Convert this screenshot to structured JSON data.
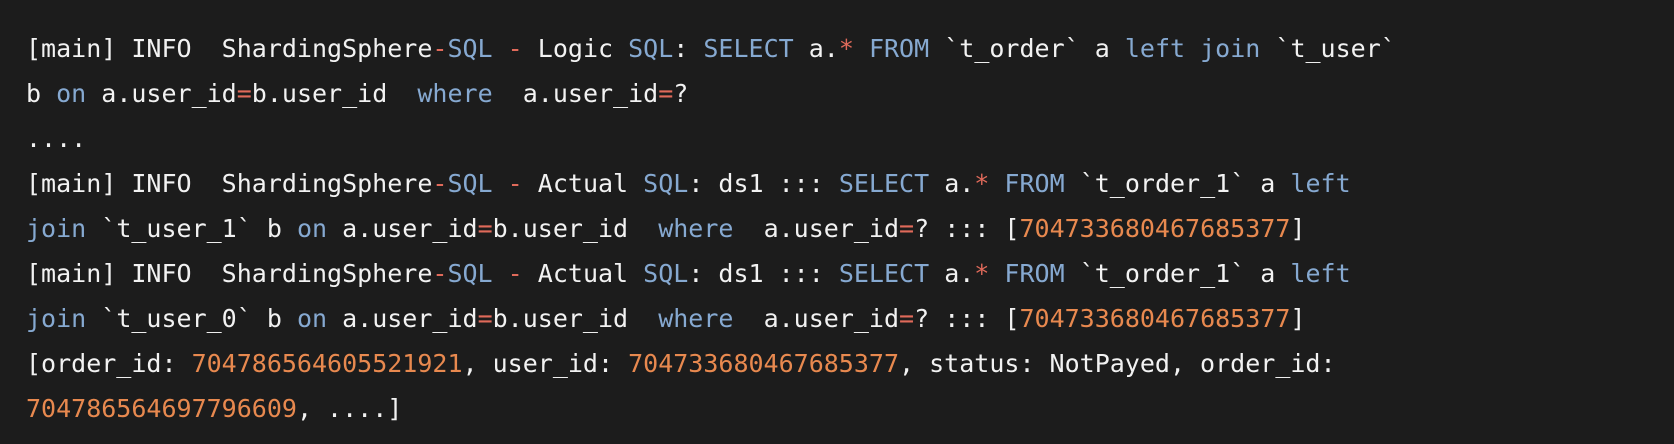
{
  "colors": {
    "background": "#1c1c1c",
    "default": "#f2f2f2",
    "keyword": "#86a9d1",
    "operator": "#e06a5a",
    "number": "#e8894f"
  },
  "code_lines": [
    [
      {
        "t": "[main] INFO  ShardingSphere",
        "c": "default"
      },
      {
        "t": "-",
        "c": "operator"
      },
      {
        "t": "SQL",
        "c": "keyword"
      },
      {
        "t": " ",
        "c": "default"
      },
      {
        "t": "-",
        "c": "operator"
      },
      {
        "t": " Logic ",
        "c": "default"
      },
      {
        "t": "SQL",
        "c": "keyword"
      },
      {
        "t": ": ",
        "c": "default"
      },
      {
        "t": "SELECT",
        "c": "keyword"
      },
      {
        "t": " a.",
        "c": "default"
      },
      {
        "t": "*",
        "c": "operator"
      },
      {
        "t": " ",
        "c": "default"
      },
      {
        "t": "FROM",
        "c": "keyword"
      },
      {
        "t": " `t_order` a ",
        "c": "default"
      },
      {
        "t": "left",
        "c": "keyword"
      },
      {
        "t": " ",
        "c": "default"
      },
      {
        "t": "join",
        "c": "keyword"
      },
      {
        "t": " `t_user`",
        "c": "default"
      }
    ],
    [
      {
        "t": "b ",
        "c": "default"
      },
      {
        "t": "on",
        "c": "keyword"
      },
      {
        "t": " a.user_id",
        "c": "default"
      },
      {
        "t": "=",
        "c": "operator"
      },
      {
        "t": "b.user_id  ",
        "c": "default"
      },
      {
        "t": "where",
        "c": "keyword"
      },
      {
        "t": "  a.user_id",
        "c": "default"
      },
      {
        "t": "=",
        "c": "operator"
      },
      {
        "t": "?",
        "c": "default"
      }
    ],
    [
      {
        "t": "....",
        "c": "default"
      }
    ],
    [
      {
        "t": "[main] INFO  ShardingSphere",
        "c": "default"
      },
      {
        "t": "-",
        "c": "operator"
      },
      {
        "t": "SQL",
        "c": "keyword"
      },
      {
        "t": " ",
        "c": "default"
      },
      {
        "t": "-",
        "c": "operator"
      },
      {
        "t": " Actual ",
        "c": "default"
      },
      {
        "t": "SQL",
        "c": "keyword"
      },
      {
        "t": ": ds1 ::: ",
        "c": "default"
      },
      {
        "t": "SELECT",
        "c": "keyword"
      },
      {
        "t": " a.",
        "c": "default"
      },
      {
        "t": "*",
        "c": "operator"
      },
      {
        "t": " ",
        "c": "default"
      },
      {
        "t": "FROM",
        "c": "keyword"
      },
      {
        "t": " `t_order_1` a ",
        "c": "default"
      },
      {
        "t": "left",
        "c": "keyword"
      }
    ],
    [
      {
        "t": "join",
        "c": "keyword"
      },
      {
        "t": " `t_user_1` b ",
        "c": "default"
      },
      {
        "t": "on",
        "c": "keyword"
      },
      {
        "t": " a.user_id",
        "c": "default"
      },
      {
        "t": "=",
        "c": "operator"
      },
      {
        "t": "b.user_id  ",
        "c": "default"
      },
      {
        "t": "where",
        "c": "keyword"
      },
      {
        "t": "  a.user_id",
        "c": "default"
      },
      {
        "t": "=",
        "c": "operator"
      },
      {
        "t": "? ::: [",
        "c": "default"
      },
      {
        "t": "704733680467685377",
        "c": "number"
      },
      {
        "t": "]",
        "c": "default"
      }
    ],
    [
      {
        "t": "[main] INFO  ShardingSphere",
        "c": "default"
      },
      {
        "t": "-",
        "c": "operator"
      },
      {
        "t": "SQL",
        "c": "keyword"
      },
      {
        "t": " ",
        "c": "default"
      },
      {
        "t": "-",
        "c": "operator"
      },
      {
        "t": " Actual ",
        "c": "default"
      },
      {
        "t": "SQL",
        "c": "keyword"
      },
      {
        "t": ": ds1 ::: ",
        "c": "default"
      },
      {
        "t": "SELECT",
        "c": "keyword"
      },
      {
        "t": " a.",
        "c": "default"
      },
      {
        "t": "*",
        "c": "operator"
      },
      {
        "t": " ",
        "c": "default"
      },
      {
        "t": "FROM",
        "c": "keyword"
      },
      {
        "t": " `t_order_1` a ",
        "c": "default"
      },
      {
        "t": "left",
        "c": "keyword"
      }
    ],
    [
      {
        "t": "join",
        "c": "keyword"
      },
      {
        "t": " `t_user_0` b ",
        "c": "default"
      },
      {
        "t": "on",
        "c": "keyword"
      },
      {
        "t": " a.user_id",
        "c": "default"
      },
      {
        "t": "=",
        "c": "operator"
      },
      {
        "t": "b.user_id  ",
        "c": "default"
      },
      {
        "t": "where",
        "c": "keyword"
      },
      {
        "t": "  a.user_id",
        "c": "default"
      },
      {
        "t": "=",
        "c": "operator"
      },
      {
        "t": "? ::: [",
        "c": "default"
      },
      {
        "t": "704733680467685377",
        "c": "number"
      },
      {
        "t": "]",
        "c": "default"
      }
    ],
    [
      {
        "t": "[order_id: ",
        "c": "default"
      },
      {
        "t": "704786564605521921",
        "c": "number"
      },
      {
        "t": ", user_id: ",
        "c": "default"
      },
      {
        "t": "704733680467685377",
        "c": "number"
      },
      {
        "t": ", status: NotPayed, order_id:",
        "c": "default"
      }
    ],
    [
      {
        "t": "704786564697796609",
        "c": "number"
      },
      {
        "t": ", ....]",
        "c": "default"
      }
    ]
  ]
}
